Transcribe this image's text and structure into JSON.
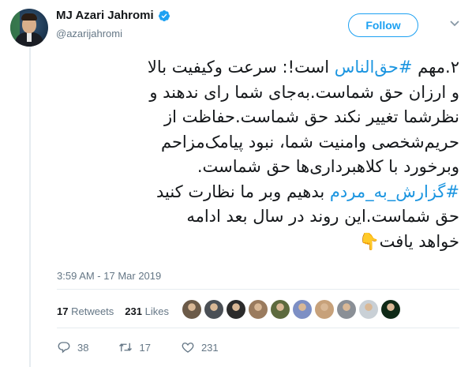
{
  "author": {
    "name": "MJ Azari Jahromi",
    "handle": "@azarijahromi",
    "verified": true
  },
  "follow_button": {
    "label": "Follow"
  },
  "tweet": {
    "lines": [
      {
        "prefix": "۲.مهم ",
        "tag": "#حق‌الناس",
        "suffix": " است!: سرعت وکیفیت بالا"
      },
      {
        "text": "و ارزان حق شماست.به‌جای شما رای ندهند و"
      },
      {
        "text": "نظرشما تغییر نکند حق شماست.حفاظت از"
      },
      {
        "text": "حریم‌شخصی وامنیت شما، نبود پیامک‌مزاحم"
      },
      {
        "text": "وبرخورد با کلاهبرداری‌ها حق شماست."
      },
      {
        "tag": "#گزارش_به_مردم",
        "suffix": " بدهیم وبر ما نظارت کنید"
      },
      {
        "text": "حق شماست.این روند در سال بعد ادامه"
      },
      {
        "text": "خواهد یافت",
        "emoji": "👇"
      }
    ]
  },
  "timestamp": "3:59 AM - 17 Mar 2019",
  "stats": {
    "retweets_count": "17",
    "retweets_label": "Retweets",
    "likes_count": "231",
    "likes_label": "Likes"
  },
  "liker_avatar_colors": [
    "#6b5a48",
    "#4a4f55",
    "#2b2b2b",
    "#9a7b5e",
    "#5d6a3e",
    "#7d8fc4",
    "#c7a17a",
    "#8a8f96",
    "#c9d0d6",
    "#0f2a17"
  ],
  "actions": {
    "replies": "38",
    "retweets": "17",
    "likes": "231"
  },
  "colors": {
    "accent": "#1da1f2",
    "hashtag": "#1b95e0",
    "muted": "#657786"
  }
}
